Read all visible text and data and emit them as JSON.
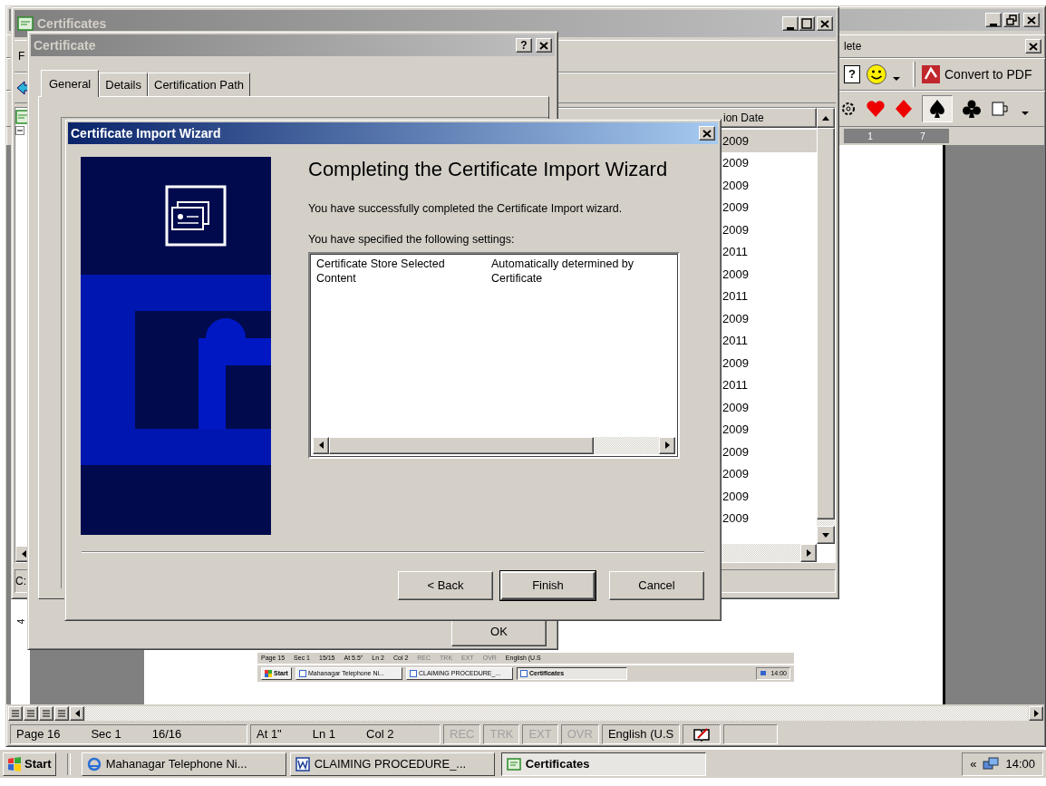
{
  "word_window": {
    "menu_fragment": "lete",
    "help_glyph": "?",
    "convert_label": "Convert to PDF",
    "ruler_marks": [
      "1",
      "7"
    ],
    "vertical_ruler_mark": "4",
    "status_bar": [
      {
        "fields": [
          {
            "text": "Page 16",
            "disabled": false
          },
          {
            "text": "Sec 1",
            "disabled": false
          },
          {
            "text": "16/16",
            "disabled": false
          }
        ]
      },
      {
        "fields": [
          {
            "text": "At 1\"",
            "disabled": false
          },
          {
            "text": "Ln 1",
            "disabled": false
          },
          {
            "text": "Col 2",
            "disabled": false
          }
        ]
      },
      {
        "fields": [
          {
            "text": "REC",
            "disabled": true
          }
        ]
      },
      {
        "fields": [
          {
            "text": "TRK",
            "disabled": true
          }
        ]
      },
      {
        "fields": [
          {
            "text": "EXT",
            "disabled": true
          }
        ]
      },
      {
        "fields": [
          {
            "text": "OVR",
            "disabled": true
          }
        ]
      },
      {
        "fields": [
          {
            "text": "English (U.S",
            "disabled": false
          }
        ]
      }
    ],
    "embedded_screenshot": {
      "status_fields": [
        {
          "text": "Page 15",
          "disabled": false
        },
        {
          "text": "Sec 1",
          "disabled": false
        },
        {
          "text": "15/15",
          "disabled": false
        },
        {
          "text": "At 5.5\"",
          "disabled": false
        },
        {
          "text": "Ln 2",
          "disabled": false
        },
        {
          "text": "Col 2",
          "disabled": false
        },
        {
          "text": "REC",
          "disabled": true
        },
        {
          "text": "TRK",
          "disabled": true
        },
        {
          "text": "EXT",
          "disabled": true
        },
        {
          "text": "OVR",
          "disabled": true
        },
        {
          "text": "English (U.S",
          "disabled": false
        }
      ],
      "start": "Start",
      "tasks": [
        {
          "label": "Mahanagar Telephone Ni...",
          "active": false
        },
        {
          "label": "CLAIMING PROCEDURE_...",
          "active": false
        },
        {
          "label": "Certificates",
          "active": true
        }
      ],
      "clock": "14:00"
    }
  },
  "certificates_window": {
    "title": "Certificates",
    "menu_fragment": "F",
    "path_fragment": "C:",
    "column_header": "ion Date",
    "rows": [
      {
        "text": "2009",
        "selected": true
      },
      {
        "text": "2009",
        "selected": false
      },
      {
        "text": "2009",
        "selected": false
      },
      {
        "text": "2009",
        "selected": false
      },
      {
        "text": "2009",
        "selected": false
      },
      {
        "text": "2011",
        "selected": false
      },
      {
        "text": "2009",
        "selected": false
      },
      {
        "text": "2011",
        "selected": false
      },
      {
        "text": "2009",
        "selected": false
      },
      {
        "text": "2011",
        "selected": false
      },
      {
        "text": "2009",
        "selected": false
      },
      {
        "text": "2011",
        "selected": false
      },
      {
        "text": "2009",
        "selected": false
      },
      {
        "text": "2009",
        "selected": false
      },
      {
        "text": "2009",
        "selected": false
      },
      {
        "text": "2009",
        "selected": false
      },
      {
        "text": "2009",
        "selected": false
      },
      {
        "text": "2009",
        "selected": false
      }
    ]
  },
  "certificate_dialog": {
    "title": "Certificate",
    "help_label": "?",
    "tabs": [
      {
        "label": "General",
        "selected": true
      },
      {
        "label": "Details",
        "selected": false
      },
      {
        "label": "Certification Path",
        "selected": false
      }
    ],
    "ok_label": "OK"
  },
  "wizard": {
    "title": "Certificate Import Wizard",
    "heading": "Completing the Certificate Import Wizard",
    "message": "You have successfully completed the Certificate Import wizard.",
    "settings_label": "You have specified the following settings:",
    "settings": [
      {
        "name": "Certificate Store Selected",
        "value": "Automatically determined by"
      },
      {
        "name": "Content",
        "value": "Certificate"
      }
    ],
    "buttons": [
      {
        "label": "< Back",
        "default": false
      },
      {
        "label": "Finish",
        "default": true
      },
      {
        "label": "Cancel",
        "default": false
      }
    ]
  },
  "taskbar": {
    "start": "Start",
    "tasks": [
      {
        "label": "Mahanagar Telephone Ni...",
        "active": false
      },
      {
        "label": "CLAIMING PROCEDURE_...",
        "active": false
      },
      {
        "label": "Certificates",
        "active": true
      }
    ],
    "tray_expand": "«",
    "clock": "14:00"
  }
}
